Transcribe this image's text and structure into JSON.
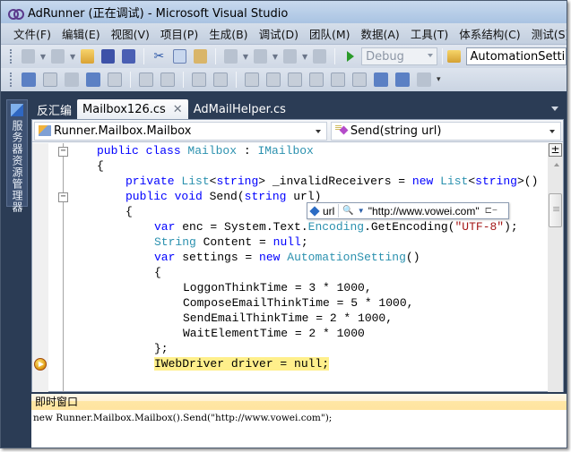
{
  "window": {
    "title": "AdRunner (正在调试) - Microsoft Visual Studio"
  },
  "menu": {
    "items": [
      "文件(F)",
      "编辑(E)",
      "视图(V)",
      "项目(P)",
      "生成(B)",
      "调试(D)",
      "团队(M)",
      "数据(A)",
      "工具(T)",
      "体系结构(C)",
      "测试(S)"
    ]
  },
  "toolbar": {
    "solution_config": "Debug",
    "find_value": "AutomationSetting"
  },
  "sidebar": {
    "label": "服务器资源管理器"
  },
  "tabs": [
    {
      "label": "反汇编",
      "active": false
    },
    {
      "label": "Mailbox126.cs",
      "active": true
    },
    {
      "label": "AdMailHelper.cs",
      "active": false
    }
  ],
  "navbar": {
    "type_selector": "Runner.Mailbox.Mailbox",
    "member_selector": "Send(string url)"
  },
  "code": {
    "lines": [
      "public class Mailbox : IMailbox",
      "{",
      "private List<string> _invalidReceivers = new List<string>()",
      "public void Send(string url)",
      "{",
      "var enc = System.Text.Encoding.GetEncoding(\"UTF-8\");",
      "String Content = null;",
      "var settings = new AutomationSetting()",
      "{",
      "LoggonThinkTime = 3 * 1000,",
      "ComposeEmailThinkTime = 5 * 1000,",
      "SendEmailThinkTime = 2 * 1000,",
      "WaitElementTime = 2 * 1000",
      "};",
      "IWebDriver driver = null;"
    ],
    "current_line": "IWebDriver driver = null;"
  },
  "datatip": {
    "name": "url",
    "value": "\"http://www.vowei.com\""
  },
  "immediate": {
    "title": "即时窗口",
    "command": "new Runner.Mailbox.Mailbox().Send(\"http://www.vowei.com\");"
  },
  "colors": {
    "keyword": "#0000ff",
    "type": "#2b91af",
    "string": "#a31515",
    "current_statement": "#ffef8b",
    "chrome_dark": "#2b3c55"
  }
}
